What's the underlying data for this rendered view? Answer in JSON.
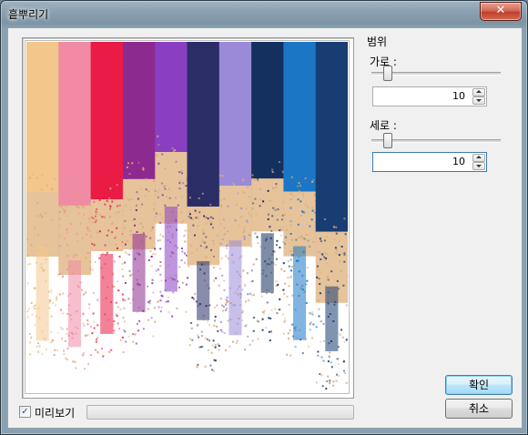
{
  "window": {
    "title": "흩뿌리기",
    "close_glyph": "✕"
  },
  "range_group": {
    "label": "범위",
    "horizontal": {
      "label": "가로 :",
      "value": "10",
      "slider_fraction": 0.1
    },
    "vertical": {
      "label": "세로 :",
      "value": "10",
      "slider_fraction": 0.1
    }
  },
  "buttons": {
    "ok_label": "확인",
    "cancel_label": "취소"
  },
  "preview": {
    "checkbox_label": "미리보기",
    "checked": true,
    "check_glyph": "✓",
    "progress_fraction": 0
  },
  "colors": {
    "default_button_border": "#3c7fb1",
    "progress_fill": "#06b025"
  },
  "icons": [
    "close-icon",
    "spin-up-icon",
    "spin-down-icon",
    "check-icon"
  ]
}
